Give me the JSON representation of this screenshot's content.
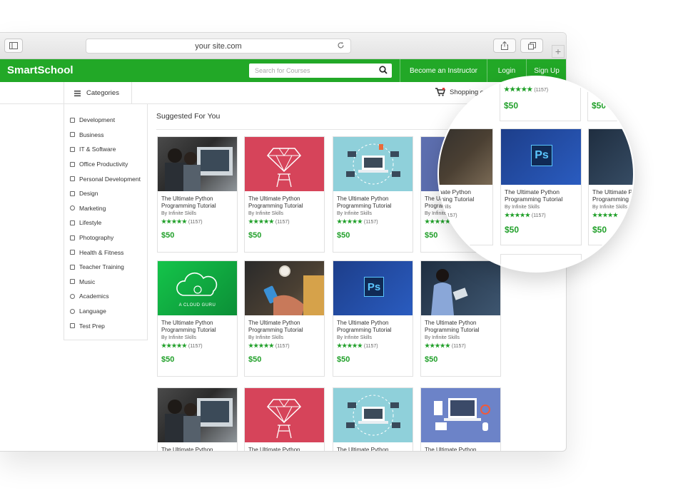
{
  "browser": {
    "url": "your site.com"
  },
  "header": {
    "logo": "SmartSchool",
    "search_placeholder": "Search for Courses",
    "nav": [
      "Become an Instructor",
      "Login",
      "Sign Up"
    ]
  },
  "subbar": {
    "categories_label": "Categories",
    "cart_label": "Shopping cart"
  },
  "sidebar": {
    "items": [
      "Development",
      "Business",
      "IT & Software",
      "Office Productivity",
      "Personal Development",
      "Design",
      "Marketing",
      "Lifestyle",
      "Photography",
      "Health & Fitness",
      "Teacher Training",
      "Music",
      "Academics",
      "Language",
      "Test Prep"
    ]
  },
  "main": {
    "section_title": "Suggested For You",
    "course": {
      "title": "The Ultimate Python Programming Tutorial",
      "title_short": "The Ultimate Python",
      "author": "By Infinite Skills",
      "stars": "★★★★★",
      "reviews": "(1157)",
      "price": "$50"
    },
    "thumb_labels": {
      "ps": "Ps",
      "cloud": "A CLOUD GURU"
    }
  },
  "colors": {
    "brand_green": "#22a827",
    "price_green": "#21a02a"
  }
}
